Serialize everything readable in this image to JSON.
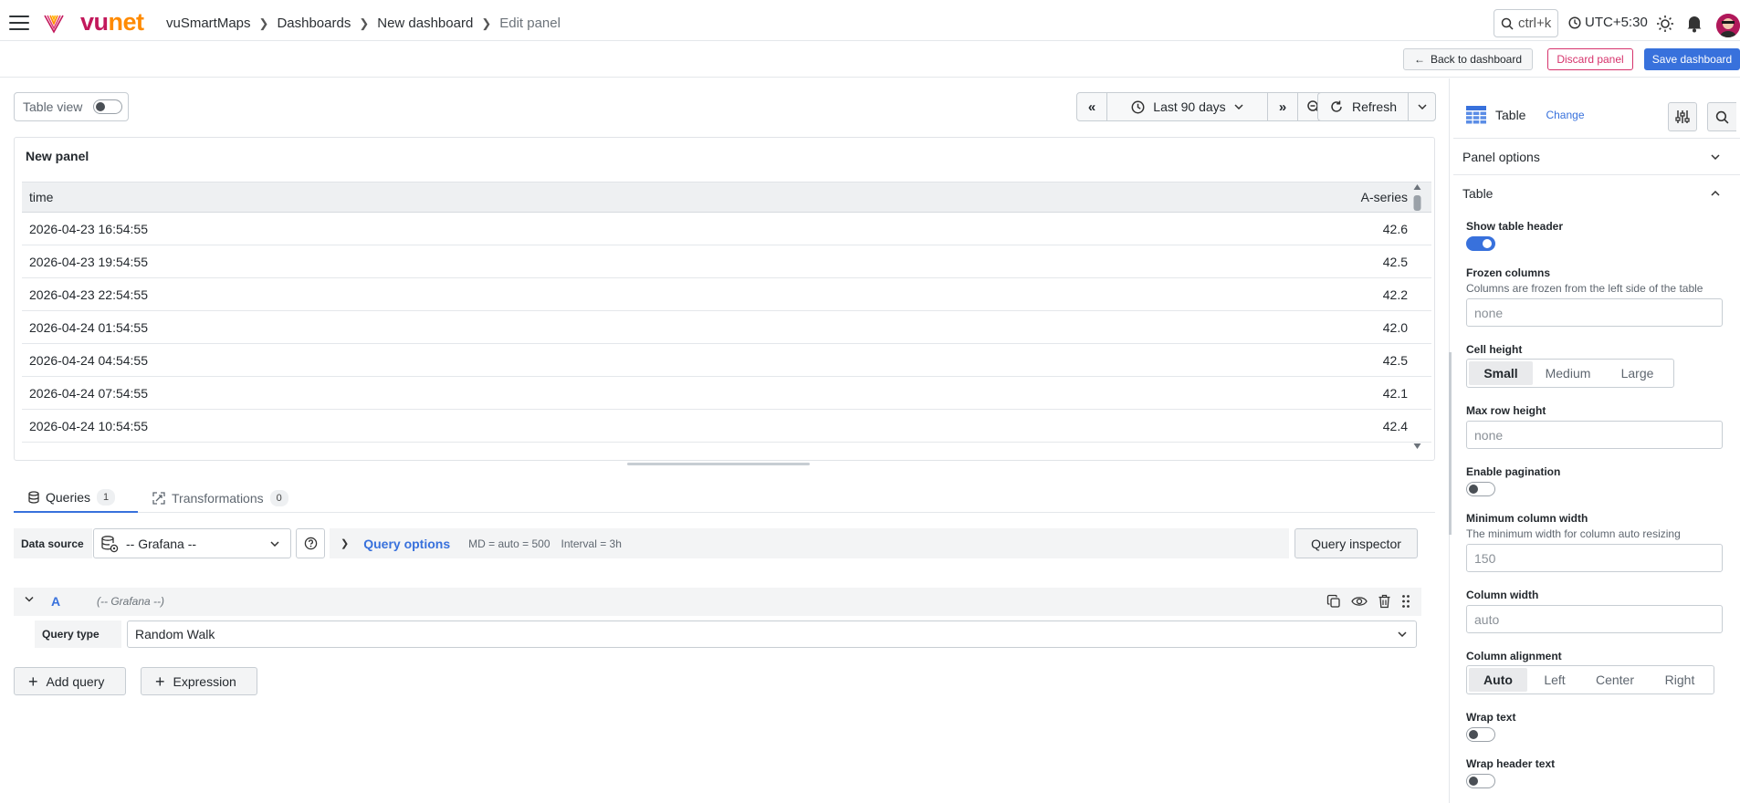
{
  "brand": {
    "part1": "vu",
    "part2": "net"
  },
  "breadcrumbs": [
    "vuSmartMaps",
    "Dashboards",
    "New dashboard",
    "Edit panel"
  ],
  "search": {
    "shortcut": "ctrl+k"
  },
  "timezone": "UTC+5:30",
  "actions": {
    "back": "Back to dashboard",
    "discard": "Discard panel",
    "save": "Save dashboard"
  },
  "toggle": {
    "label": "Table view",
    "on": false
  },
  "time_range": {
    "label": "Last 90 days",
    "refresh": "Refresh"
  },
  "panel": {
    "title": "New panel",
    "columns": [
      "time",
      "A-series"
    ],
    "rows": [
      [
        "2026-04-23 16:54:55",
        "42.6"
      ],
      [
        "2026-04-23 19:54:55",
        "42.5"
      ],
      [
        "2026-04-23 22:54:55",
        "42.2"
      ],
      [
        "2026-04-24 01:54:55",
        "42.0"
      ],
      [
        "2026-04-24 04:54:55",
        "42.5"
      ],
      [
        "2026-04-24 07:54:55",
        "42.1"
      ],
      [
        "2026-04-24 10:54:55",
        "42.4"
      ]
    ]
  },
  "tabs": [
    {
      "label": "Queries",
      "count": "1"
    },
    {
      "label": "Transformations",
      "count": "0"
    }
  ],
  "datasource": {
    "label": "Data source",
    "value": "-- Grafana --",
    "query_options_title": "Query options",
    "md": "MD = auto = 500",
    "interval": "Interval = 3h",
    "inspector": "Query inspector"
  },
  "query": {
    "letter": "A",
    "source": "(-- Grafana --)",
    "type_label": "Query type",
    "type_value": "Random Walk"
  },
  "buttons": {
    "add_query": "Add query",
    "expression": "Expression"
  },
  "viz": {
    "name": "Table",
    "change": "Change"
  },
  "sections": {
    "panel_options": "Panel options",
    "table": "Table"
  },
  "options": {
    "show_header": {
      "label": "Show table header",
      "on": true
    },
    "frozen": {
      "label": "Frozen columns",
      "desc": "Columns are frozen from the left side of the table",
      "placeholder": "none"
    },
    "cell_height": {
      "label": "Cell height",
      "options": [
        "Small",
        "Medium",
        "Large"
      ],
      "selected": "Small"
    },
    "max_row_height": {
      "label": "Max row height",
      "placeholder": "none"
    },
    "pagination": {
      "label": "Enable pagination",
      "on": false
    },
    "min_col_width": {
      "label": "Minimum column width",
      "desc": "The minimum width for column auto resizing",
      "placeholder": "150"
    },
    "col_width": {
      "label": "Column width",
      "placeholder": "auto"
    },
    "col_align": {
      "label": "Column alignment",
      "options": [
        "Auto",
        "Left",
        "Center",
        "Right"
      ],
      "selected": "Auto"
    },
    "wrap_text": {
      "label": "Wrap text",
      "on": false
    },
    "wrap_header": {
      "label": "Wrap header text",
      "on": false
    }
  },
  "colors": {
    "accent": "#3871dc",
    "danger": "#d6336c",
    "brand_pink": "#c2185b",
    "brand_orange": "#ff8a00"
  }
}
